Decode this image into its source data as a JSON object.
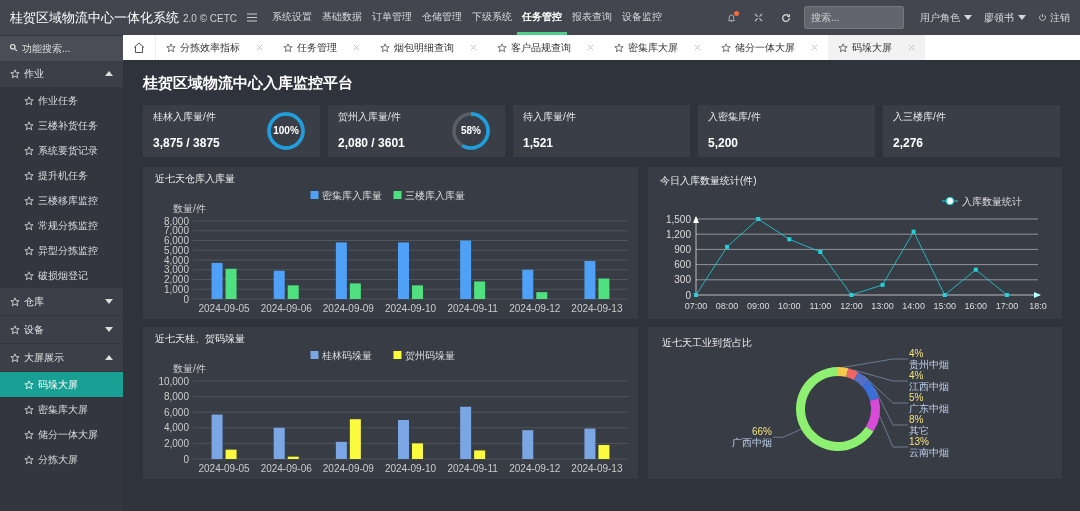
{
  "header": {
    "title": "桂贺区域物流中心一体化系统",
    "version": "2.0 © CETC",
    "has_notification": true,
    "search_placeholder": "搜索...",
    "user_menus": [
      "用户角色",
      "廖领书"
    ],
    "logout": "注销"
  },
  "nav": [
    {
      "label": "系统设置",
      "selected": false
    },
    {
      "label": "基础数据",
      "selected": false
    },
    {
      "label": "订单管理",
      "selected": false
    },
    {
      "label": "仓储管理",
      "selected": false
    },
    {
      "label": "下级系统",
      "selected": false
    },
    {
      "label": "任务管控",
      "selected": true
    },
    {
      "label": "报表查询",
      "selected": false
    },
    {
      "label": "设备监控",
      "selected": false
    }
  ],
  "sidebar": {
    "search_placeholder": "功能搜索...",
    "groups": [
      {
        "label": "作业",
        "expanded": true,
        "children": [
          {
            "label": "作业任务",
            "selected": false
          },
          {
            "label": "三楼补货任务",
            "selected": false
          },
          {
            "label": "系统要货记录",
            "selected": false
          },
          {
            "label": "提升机任务",
            "selected": false
          },
          {
            "label": "三楼移库监控",
            "selected": false
          },
          {
            "label": "常规分拣监控",
            "selected": false
          },
          {
            "label": "异型分拣监控",
            "selected": false
          },
          {
            "label": "破损烟登记",
            "selected": false
          }
        ]
      },
      {
        "label": "仓库",
        "expanded": false
      },
      {
        "label": "设备",
        "expanded": false
      },
      {
        "label": "大屏展示",
        "expanded": true,
        "children": [
          {
            "label": "码垛大屏",
            "selected": true
          },
          {
            "label": "密集库大屏",
            "selected": false
          },
          {
            "label": "储分一体大屏",
            "selected": false
          },
          {
            "label": "分拣大屏",
            "selected": false
          }
        ]
      }
    ]
  },
  "tabs": [
    {
      "label": "分拣效率指标",
      "selected": false
    },
    {
      "label": "任务管理",
      "selected": false
    },
    {
      "label": "烟包明细查询",
      "selected": false
    },
    {
      "label": "客户品规查询",
      "selected": false
    },
    {
      "label": "密集库大屏",
      "selected": false
    },
    {
      "label": "储分一体大屏",
      "selected": false
    },
    {
      "label": "码垛大屏",
      "selected": true
    }
  ],
  "page_title": "桂贺区域物流中心入库监控平台",
  "kpis": [
    {
      "label": "桂林入库量/件",
      "value": "3,875 / 3875",
      "ring": {
        "level": 1,
        "label": "100%"
      }
    },
    {
      "label": "贺州入库量/件",
      "value": "2,080 / 3601",
      "ring": {
        "level": 0.58,
        "label": "58%"
      }
    },
    {
      "label": "待入库量/件",
      "value": "1,521"
    },
    {
      "label": "入密集库/件",
      "value": "5,200"
    },
    {
      "label": "入三楼库/件",
      "value": "2,276"
    }
  ],
  "charts": [
    {
      "chart_data": {
        "type": "bar",
        "title": "近七天仓库入库量",
        "ylabel": "数量/件",
        "grid": true,
        "legend": true,
        "categories": [
          "2024-09-05",
          "2024-09-06",
          "2024-09-09",
          "2024-09-10",
          "2024-09-11",
          "2024-09-12",
          "2024-09-13"
        ],
        "series": [
          {
            "name": "密集库入库量",
            "color": "#4ea1f7",
            "values": [
              3700,
              2900,
              5800,
              5800,
              6000,
              3000,
              3900
            ]
          },
          {
            "name": "三楼库入库量",
            "color": "#4fe07f",
            "values": [
              3100,
              1400,
              1600,
              1400,
              1800,
              700,
              2100
            ]
          }
        ],
        "ylim": [
          0,
          8000
        ],
        "yticks": [
          {
            "value": 0,
            "label": "0"
          },
          {
            "value": 1000,
            "label": "1,000"
          },
          {
            "value": 2000,
            "label": "2,000"
          },
          {
            "value": 3000,
            "label": "3,000"
          },
          {
            "value": 4000,
            "label": "4,000"
          },
          {
            "value": 5000,
            "label": "5,000"
          },
          {
            "value": 6000,
            "label": "6,000"
          },
          {
            "value": 7000,
            "label": "7,000"
          },
          {
            "value": 8000,
            "label": "8,000"
          }
        ]
      }
    },
    {
      "chart_data": {
        "type": "line",
        "title": "今日入库数量统计(件)",
        "grid": true,
        "legend": true,
        "x": [
          "07:00",
          "08:00",
          "09:00",
          "10:00",
          "11:00",
          "12:00",
          "13:00",
          "14:00",
          "15:00",
          "16:00",
          "17:00",
          "18:0"
        ],
        "series": [
          {
            "name": "入库数量统计",
            "color": "#1fd3d8",
            "marker": "square",
            "values": [
              0,
              950,
              1500,
              1100,
              850,
              0,
              200,
              1250,
              0,
              500,
              0,
              null
            ]
          }
        ],
        "ylim": [
          0,
          1500
        ],
        "yticks": [
          {
            "value": 0,
            "label": "0"
          },
          {
            "value": 300,
            "label": "300"
          },
          {
            "value": 600,
            "label": "600"
          },
          {
            "value": 900,
            "label": "900"
          },
          {
            "value": 1200,
            "label": "1,200"
          },
          {
            "value": 1500,
            "label": "1,500"
          }
        ]
      }
    },
    {
      "chart_data": {
        "type": "bar",
        "title": "近七天桂、贺码垛量",
        "ylabel": "数量/件",
        "grid": true,
        "legend": true,
        "categories": [
          "2024-09-05",
          "2024-09-06",
          "2024-09-09",
          "2024-09-10",
          "2024-09-11",
          "2024-09-12",
          "2024-09-13"
        ],
        "series": [
          {
            "name": "桂林码垛量",
            "color": "#7aa7e4",
            "values": [
              5700,
              4000,
              2200,
              5000,
              6700,
              3700,
              3900
            ]
          },
          {
            "name": "贺州码垛量",
            "color": "#fbfb3e",
            "values": [
              1200,
              300,
              5100,
              2000,
              1100,
              0,
              1800
            ]
          }
        ],
        "ylim": [
          0,
          10000
        ],
        "yticks": [
          {
            "value": 0,
            "label": "0"
          },
          {
            "value": 2000,
            "label": "2,000"
          },
          {
            "value": 4000,
            "label": "4,000"
          },
          {
            "value": 6000,
            "label": "6,000"
          },
          {
            "value": 8000,
            "label": "8,000"
          },
          {
            "value": 10000,
            "label": "10,000"
          }
        ]
      }
    },
    {
      "chart_data": {
        "type": "donut",
        "title": "近七天工业到货占比",
        "categories": [
          "贵州中烟",
          "江西中烟",
          "广东中烟",
          "其它",
          "云南中烟",
          "广西中烟"
        ],
        "values": [
          4,
          4,
          5,
          8,
          13,
          66
        ],
        "value_labels": [
          "4%",
          "4%",
          "5%",
          "8%",
          "13%",
          "66%"
        ],
        "colors": [
          "#f2c94c",
          "#ee6666",
          "#5470c6",
          "#3b6fd6",
          "#d84bd8",
          "#8ef070"
        ]
      }
    }
  ]
}
